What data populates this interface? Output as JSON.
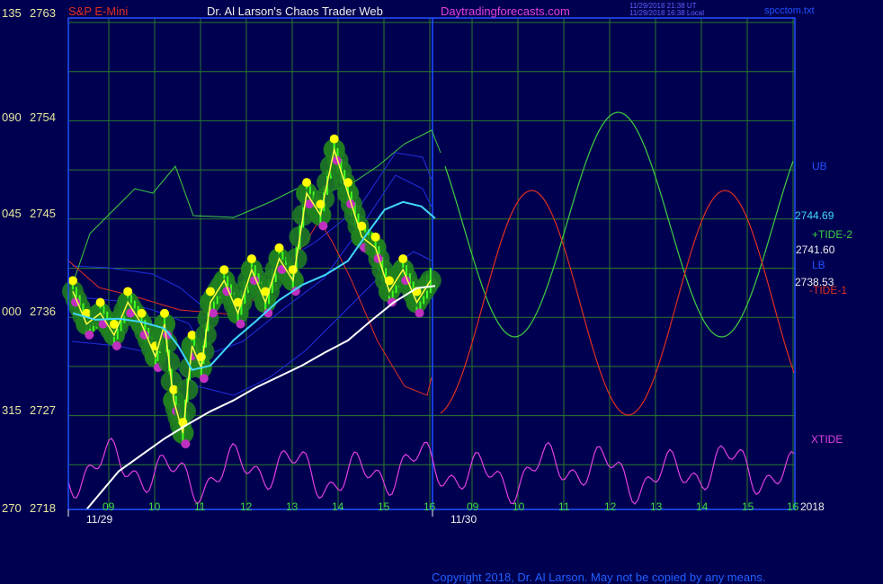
{
  "header": {
    "symbol": "S&P E-Mini",
    "title": "Dr. Al Larson's Chaos Trader Web",
    "site": "Daytradingforecasts.com",
    "time_utc": "11/29/2018 21:38 UT",
    "time_local": "11/29/2018 16:38 Local",
    "file": "spcctom.txt"
  },
  "footer": {
    "copyright": "Copyright 2018, Dr. Al Larson. May not be copied by any means."
  },
  "colors": {
    "background": "#000050",
    "grid": "#2a7a2a",
    "border": "#2050ff",
    "price": "#ffff40",
    "bands": "#40ff20",
    "dots_up": "#ffff00",
    "dots_down": "#c030c0",
    "ema_fast": "#40d8ff",
    "ema_slow": "#ffffff",
    "tide_plus": "#40d040",
    "tide_minus": "#e03020",
    "xtide": "#e040e0",
    "band_lines": "#2030e0"
  },
  "chart_data": {
    "type": "line",
    "y_axis": {
      "ticks": [
        {
          "code": "135",
          "price": "2763"
        },
        {
          "code": "090",
          "price": "2754"
        },
        {
          "code": "045",
          "price": "2745"
        },
        {
          "code": "000",
          "price": "2736"
        },
        {
          "code": "315",
          "price": "2727"
        },
        {
          "code": "270",
          "price": "2718"
        }
      ],
      "ylim": [
        2718,
        2763
      ]
    },
    "x_axis": {
      "hour_labels_day1": [
        "09",
        "10",
        "11",
        "12",
        "13",
        "14",
        "15",
        "16"
      ],
      "hour_labels_day2": [
        "09",
        "10",
        "11",
        "12",
        "13",
        "14",
        "15",
        "16"
      ],
      "date_labels": [
        "11/29",
        "11/30"
      ],
      "year": "2018"
    },
    "right_labels": {
      "ub": "UB",
      "lb": "LB",
      "tide_plus": "+TIDE-2",
      "tide_minus": "-TIDE-1",
      "xtide": "XTIDE",
      "level_ema": "2744.69",
      "level_tide": "2741.60",
      "level_price": "2738.53"
    },
    "series": [
      {
        "name": "price",
        "x": [
          0,
          0.3,
          0.6,
          0.9,
          1.2,
          1.5,
          1.8,
          2.0,
          2.2,
          2.4,
          2.6,
          2.8,
          3.0,
          3.3,
          3.6,
          3.9,
          4.2,
          4.5,
          4.8,
          5.1,
          5.4,
          5.7,
          6.0,
          6.3,
          6.6,
          6.9,
          7.2,
          7.5,
          7.8
        ],
        "y": [
          2738,
          2735,
          2736,
          2734,
          2737,
          2735,
          2732,
          2735,
          2728,
          2725,
          2733,
          2731,
          2737,
          2739,
          2736,
          2740,
          2737,
          2741,
          2739,
          2747,
          2745,
          2751,
          2747,
          2743,
          2742,
          2738,
          2740,
          2737,
          2739
        ]
      },
      {
        "name": "ema_fast",
        "x": [
          0,
          0.5,
          1,
          1.5,
          2,
          2.3,
          2.6,
          3,
          3.5,
          4,
          4.5,
          5,
          5.5,
          6,
          6.4,
          6.8,
          7.2,
          7.6,
          7.9
        ],
        "y": [
          2736,
          2735.4,
          2735.5,
          2735.2,
          2734.6,
          2733,
          2730.8,
          2731.2,
          2733.5,
          2735.3,
          2737.2,
          2738.6,
          2739.5,
          2740.8,
          2743.2,
          2745.5,
          2746.2,
          2745.8,
          2744.7
        ]
      },
      {
        "name": "ema_slow",
        "x": [
          0.3,
          1,
          2,
          2.5,
          3,
          3.5,
          4,
          4.5,
          5,
          5.5,
          6,
          6.5,
          7,
          7.5,
          7.9
        ],
        "y": [
          2718,
          2721.5,
          2724.5,
          2725.8,
          2727,
          2728,
          2729.2,
          2730.2,
          2731.2,
          2732.4,
          2733.5,
          2735.3,
          2737,
          2738.3,
          2738.5
        ]
      }
    ]
  }
}
